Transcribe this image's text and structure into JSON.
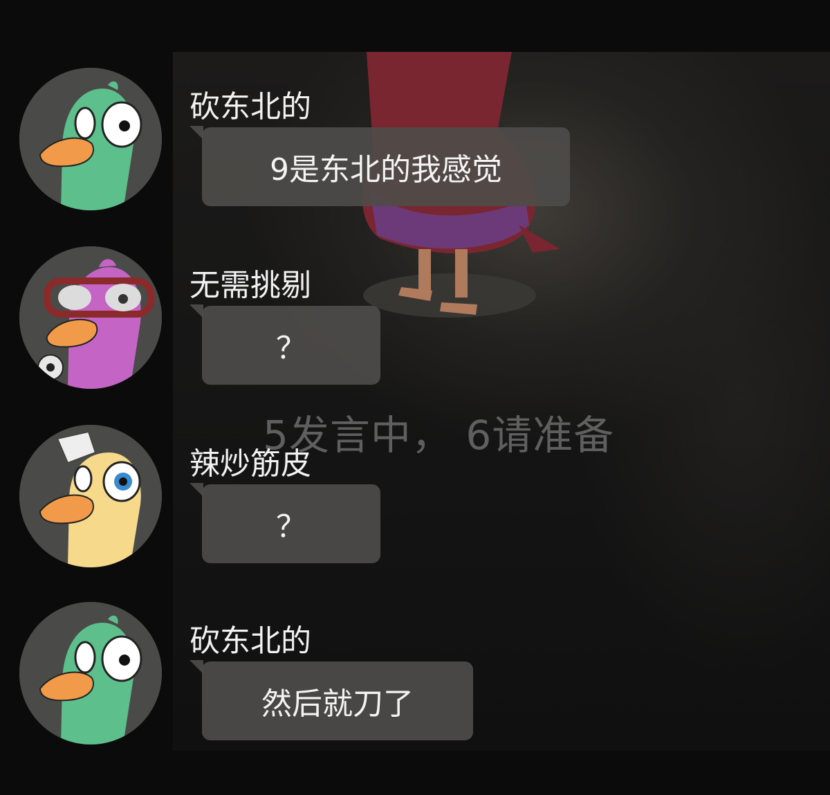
{
  "announcement": "5发言中， 6请准备",
  "messages": [
    {
      "username": "砍东北的",
      "text": "9是东北的我感觉",
      "avatar": "green-duck-avatar"
    },
    {
      "username": "无需挑剔",
      "text": "？",
      "avatar": "purple-duck-goggles-avatar"
    },
    {
      "username": "辣炒筋皮",
      "text": "？",
      "avatar": "yellow-duck-avatar"
    },
    {
      "username": "砍东北的",
      "text": "然后就刀了",
      "avatar": "green-duck-avatar"
    }
  ],
  "colors": {
    "bubble": "#4e4c4a",
    "text": "#f4f4f4",
    "announcement": "#787878",
    "green_duck": "#5cbf8c",
    "purple_duck": "#c464c4",
    "yellow_duck": "#f6d98a",
    "beak": "#f19a4a"
  }
}
